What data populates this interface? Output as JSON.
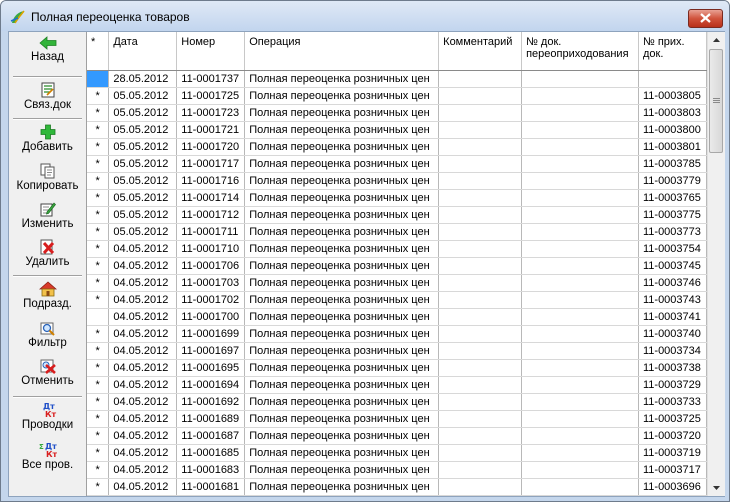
{
  "window": {
    "title": "Полная переоценка товаров"
  },
  "toolbar": [
    {
      "label": "Назад",
      "icon": "back-arrow-icon"
    },
    {
      "label": "Связ.док",
      "icon": "linked-doc-icon"
    },
    {
      "label": "Добавить",
      "icon": "add-icon"
    },
    {
      "label": "Копировать",
      "icon": "copy-icon"
    },
    {
      "label": "Изменить",
      "icon": "edit-icon"
    },
    {
      "label": "Удалить",
      "icon": "delete-icon"
    },
    {
      "label": "Подразд.",
      "icon": "house-icon"
    },
    {
      "label": "Фильтр",
      "icon": "filter-icon"
    },
    {
      "label": "Отменить",
      "icon": "cancel-filter-icon"
    },
    {
      "label": "Проводки",
      "icon": "postings-icon"
    },
    {
      "label": "Все пров.",
      "icon": "all-postings-icon"
    }
  ],
  "grid": {
    "columns": [
      "*",
      "Дата",
      "Номер",
      "Операция",
      "Комментарий",
      "№ док. переоприходования",
      "№ прих. док."
    ],
    "rows": [
      {
        "mark": "",
        "date": "28.05.2012",
        "number": "11-0001737",
        "operation": "Полная переоценка розничных цен",
        "comment": "",
        "redoc": "",
        "incoming": "",
        "selected": true
      },
      {
        "mark": "*",
        "date": "05.05.2012",
        "number": "11-0001725",
        "operation": "Полная переоценка розничных цен",
        "comment": "",
        "redoc": "",
        "incoming": "11-0003805"
      },
      {
        "mark": "*",
        "date": "05.05.2012",
        "number": "11-0001723",
        "operation": "Полная переоценка розничных цен",
        "comment": "",
        "redoc": "",
        "incoming": "11-0003803"
      },
      {
        "mark": "*",
        "date": "05.05.2012",
        "number": "11-0001721",
        "operation": "Полная переоценка розничных цен",
        "comment": "",
        "redoc": "",
        "incoming": "11-0003800"
      },
      {
        "mark": "*",
        "date": "05.05.2012",
        "number": "11-0001720",
        "operation": "Полная переоценка розничных цен",
        "comment": "",
        "redoc": "",
        "incoming": "11-0003801"
      },
      {
        "mark": "*",
        "date": "05.05.2012",
        "number": "11-0001717",
        "operation": "Полная переоценка розничных цен",
        "comment": "",
        "redoc": "",
        "incoming": "11-0003785"
      },
      {
        "mark": "*",
        "date": "05.05.2012",
        "number": "11-0001716",
        "operation": "Полная переоценка розничных цен",
        "comment": "",
        "redoc": "",
        "incoming": "11-0003779"
      },
      {
        "mark": "*",
        "date": "05.05.2012",
        "number": "11-0001714",
        "operation": "Полная переоценка розничных цен",
        "comment": "",
        "redoc": "",
        "incoming": "11-0003765"
      },
      {
        "mark": "*",
        "date": "05.05.2012",
        "number": "11-0001712",
        "operation": "Полная переоценка розничных цен",
        "comment": "",
        "redoc": "",
        "incoming": "11-0003775"
      },
      {
        "mark": "*",
        "date": "05.05.2012",
        "number": "11-0001711",
        "operation": "Полная переоценка розничных цен",
        "comment": "",
        "redoc": "",
        "incoming": "11-0003773"
      },
      {
        "mark": "*",
        "date": "04.05.2012",
        "number": "11-0001710",
        "operation": "Полная переоценка розничных цен",
        "comment": "",
        "redoc": "",
        "incoming": "11-0003754"
      },
      {
        "mark": "*",
        "date": "04.05.2012",
        "number": "11-0001706",
        "operation": "Полная переоценка розничных цен",
        "comment": "",
        "redoc": "",
        "incoming": "11-0003745"
      },
      {
        "mark": "*",
        "date": "04.05.2012",
        "number": "11-0001703",
        "operation": "Полная переоценка розничных цен",
        "comment": "",
        "redoc": "",
        "incoming": "11-0003746"
      },
      {
        "mark": "*",
        "date": "04.05.2012",
        "number": "11-0001702",
        "operation": "Полная переоценка розничных цен",
        "comment": "",
        "redoc": "",
        "incoming": "11-0003743"
      },
      {
        "mark": "",
        "date": "04.05.2012",
        "number": "11-0001700",
        "operation": "Полная переоценка розничных цен",
        "comment": "",
        "redoc": "",
        "incoming": "11-0003741"
      },
      {
        "mark": "*",
        "date": "04.05.2012",
        "number": "11-0001699",
        "operation": "Полная переоценка розничных цен",
        "comment": "",
        "redoc": "",
        "incoming": "11-0003740"
      },
      {
        "mark": "*",
        "date": "04.05.2012",
        "number": "11-0001697",
        "operation": "Полная переоценка розничных цен",
        "comment": "",
        "redoc": "",
        "incoming": "11-0003734"
      },
      {
        "mark": "*",
        "date": "04.05.2012",
        "number": "11-0001695",
        "operation": "Полная переоценка розничных цен",
        "comment": "",
        "redoc": "",
        "incoming": "11-0003738"
      },
      {
        "mark": "*",
        "date": "04.05.2012",
        "number": "11-0001694",
        "operation": "Полная переоценка розничных цен",
        "comment": "",
        "redoc": "",
        "incoming": "11-0003729"
      },
      {
        "mark": "*",
        "date": "04.05.2012",
        "number": "11-0001692",
        "operation": "Полная переоценка розничных цен",
        "comment": "",
        "redoc": "",
        "incoming": "11-0003733"
      },
      {
        "mark": "*",
        "date": "04.05.2012",
        "number": "11-0001689",
        "operation": "Полная переоценка розничных цен",
        "comment": "",
        "redoc": "",
        "incoming": "11-0003725"
      },
      {
        "mark": "*",
        "date": "04.05.2012",
        "number": "11-0001687",
        "operation": "Полная переоценка розничных цен",
        "comment": "",
        "redoc": "",
        "incoming": "11-0003720"
      },
      {
        "mark": "*",
        "date": "04.05.2012",
        "number": "11-0001685",
        "operation": "Полная переоценка розничных цен",
        "comment": "",
        "redoc": "",
        "incoming": "11-0003719"
      },
      {
        "mark": "*",
        "date": "04.05.2012",
        "number": "11-0001683",
        "operation": "Полная переоценка розничных цен",
        "comment": "",
        "redoc": "",
        "incoming": "11-0003717"
      },
      {
        "mark": "*",
        "date": "04.05.2012",
        "number": "11-0001681",
        "operation": "Полная переоценка розничных цен",
        "comment": "",
        "redoc": "",
        "incoming": "11-0003696"
      }
    ]
  }
}
